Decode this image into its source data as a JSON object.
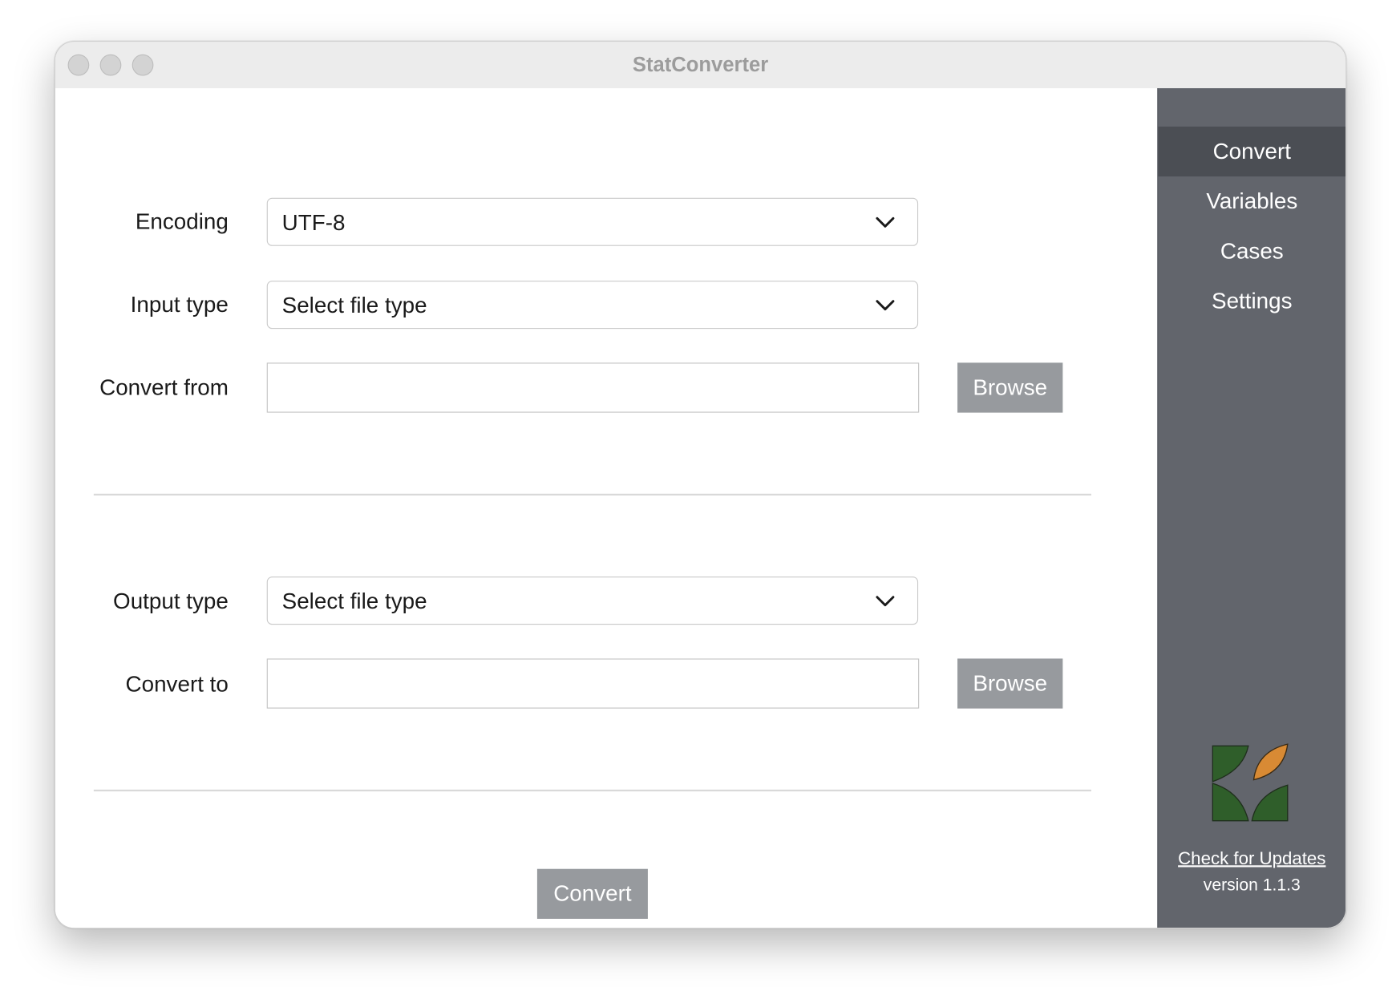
{
  "window": {
    "title": "StatConverter"
  },
  "form": {
    "encoding": {
      "label": "Encoding",
      "value": "UTF-8"
    },
    "input_type": {
      "label": "Input type",
      "value": "Select file type"
    },
    "convert_from": {
      "label": "Convert from",
      "value": "",
      "browse_label": "Browse"
    },
    "output_type": {
      "label": "Output type",
      "value": "Select file type"
    },
    "convert_to": {
      "label": "Convert to",
      "value": "",
      "browse_label": "Browse"
    },
    "convert_button_label": "Convert"
  },
  "sidebar": {
    "items": [
      {
        "label": "Convert",
        "active": true
      },
      {
        "label": "Variables",
        "active": false
      },
      {
        "label": "Cases",
        "active": false
      },
      {
        "label": "Settings",
        "active": false
      }
    ],
    "check_updates_label": "Check for Updates",
    "version_text": "version 1.1.3"
  },
  "colors": {
    "sidebar_bg": "#62656c",
    "sidebar_active": "#4b4e54",
    "button_bg": "#979a9e",
    "logo_green": "#2f5e2a",
    "logo_orange": "#d88a34"
  }
}
